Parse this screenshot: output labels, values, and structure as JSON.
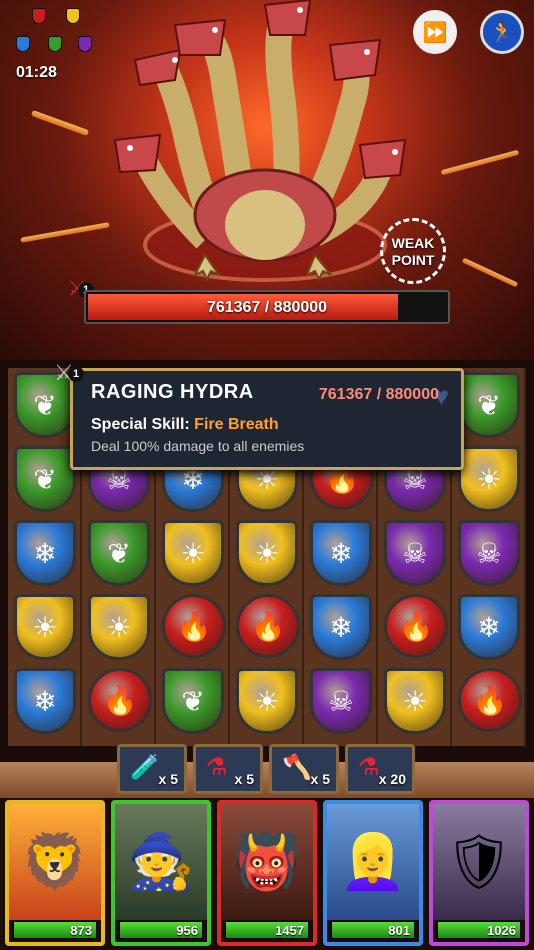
{
  "battle": {
    "timer": "01:28",
    "boss": {
      "name": "RAGING HYDRA",
      "hp_text": "761367 / 880000",
      "hp_fraction": 0.865,
      "level": "1",
      "weak_point_label": "WEAK POINT",
      "skill_label": "Special Skill:",
      "skill_name": "Fire Breath",
      "skill_description": "Deal 100% damage to all enemies"
    },
    "buttons": {
      "fast_forward_icon": "fast-forward-icon",
      "flee_icon": "running-man-icon"
    }
  },
  "board": {
    "colors": {
      "green": "#3a9a2a",
      "blue": "#2a7ad8",
      "yellow": "#f0c020",
      "red": "#c81e1e",
      "purple": "#7a2ab0"
    },
    "rows": [
      [
        "green",
        "blue",
        "blue",
        "yellow",
        "red",
        "purple",
        "green"
      ],
      [
        "green",
        "purple",
        "blue",
        "yellow",
        "red",
        "purple",
        "yellow"
      ],
      [
        "blue",
        "green",
        "yellow",
        "yellow",
        "blue",
        "purple",
        "purple"
      ],
      [
        "yellow",
        "yellow",
        "red",
        "red",
        "blue",
        "red",
        "blue"
      ],
      [
        "blue",
        "red",
        "green",
        "yellow",
        "purple",
        "yellow",
        "red"
      ]
    ]
  },
  "items": [
    {
      "name": "mana-potion",
      "icon": "blue-potion-icon",
      "count": "x 5"
    },
    {
      "name": "health-potion",
      "icon": "red-potion-icon",
      "count": "x 5"
    },
    {
      "name": "axe",
      "icon": "axe-icon",
      "count": "x 5"
    },
    {
      "name": "tonic",
      "icon": "red-tonic-icon",
      "count": "x 20"
    }
  ],
  "heroes": [
    {
      "name": "red-beast-warrior",
      "color": "#e8b820",
      "hp": "873",
      "hp_fraction": 1.0
    },
    {
      "name": "wizard",
      "color": "#3ac82a",
      "hp": "956",
      "hp_fraction": 1.0
    },
    {
      "name": "orc-pirate",
      "color": "#d82a2a",
      "hp": "1457",
      "hp_fraction": 1.0
    },
    {
      "name": "blonde-heroine",
      "color": "#3a8ae8",
      "hp": "801",
      "hp_fraction": 1.0
    },
    {
      "name": "armored-knight",
      "color": "#c04ad8",
      "hp": "1026",
      "hp_fraction": 1.0
    }
  ]
}
